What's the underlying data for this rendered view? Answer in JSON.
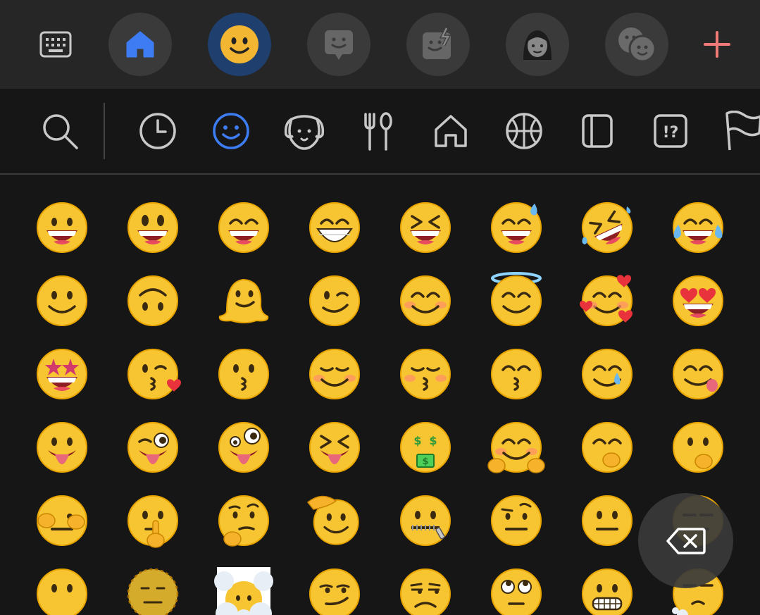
{
  "top_bar": {
    "items": [
      {
        "name": "keyboard-icon",
        "state": "normal"
      },
      {
        "name": "home-icon",
        "state": "normal",
        "accent": "#3d7cf2"
      },
      {
        "name": "emoji-tab-icon",
        "state": "selected",
        "accent": "#f2b632"
      },
      {
        "name": "bitmoji-sticker-icon",
        "state": "normal"
      },
      {
        "name": "ar-sticker-icon",
        "state": "normal"
      },
      {
        "name": "avatar-icon",
        "state": "normal"
      },
      {
        "name": "emoji-mix-icon",
        "state": "normal"
      },
      {
        "name": "add-icon",
        "state": "normal",
        "accent": "#f07a78"
      }
    ]
  },
  "category_bar": {
    "items": [
      {
        "name": "search-icon"
      },
      {
        "name": "recent-clock-icon"
      },
      {
        "name": "smileys-icon",
        "selected": true,
        "accent": "#3d7cf2"
      },
      {
        "name": "animals-icon"
      },
      {
        "name": "food-icon"
      },
      {
        "name": "places-icon"
      },
      {
        "name": "activities-icon"
      },
      {
        "name": "objects-icon"
      },
      {
        "name": "symbols-icon"
      },
      {
        "name": "flags-icon"
      }
    ]
  },
  "emojis": [
    "grinning-face",
    "grinning-face-big-eyes",
    "grinning-face-smiling-eyes",
    "beaming-face",
    "grinning-squinting-face",
    "grinning-face-sweat",
    "rolling-on-floor-laughing",
    "face-tears-of-joy",
    "slightly-smiling-face",
    "upside-down-face",
    "melting-face",
    "winking-face",
    "smiling-face-smiling-eyes",
    "smiling-face-halo",
    "smiling-face-hearts",
    "smiling-face-heart-eyes",
    "star-struck",
    "face-blowing-kiss",
    "kissing-face",
    "smiling-face",
    "kissing-face-closed-eyes",
    "kissing-face-smiling-eyes",
    "smiling-face-tear",
    "face-savoring-food",
    "face-with-tongue",
    "winking-face-tongue",
    "zany-face",
    "squinting-face-tongue",
    "money-mouth-face",
    "hugging-face",
    "face-hand-over-mouth",
    "face-open-eyes-hand-over-mouth",
    "face-peeking-eye",
    "shushing-face",
    "thinking-face",
    "saluting-face",
    "zipper-mouth-face",
    "face-raised-eyebrow",
    "neutral-face",
    "expressionless-face",
    "face-without-mouth",
    "dotted-line-face",
    "face-in-clouds",
    "smirking-face",
    "unamused-face",
    "face-rolling-eyes",
    "grimacing-face",
    "face-exhaling"
  ],
  "colors": {
    "face": "#f7c531",
    "face_edge": "#e8a400",
    "mouth": "#8c1e24",
    "tongue": "#e9677a",
    "blush": "#ff8f6b",
    "accent_blue": "#3d7cf2",
    "plus_red": "#f07a78"
  },
  "backspace": {
    "name": "backspace-icon"
  }
}
